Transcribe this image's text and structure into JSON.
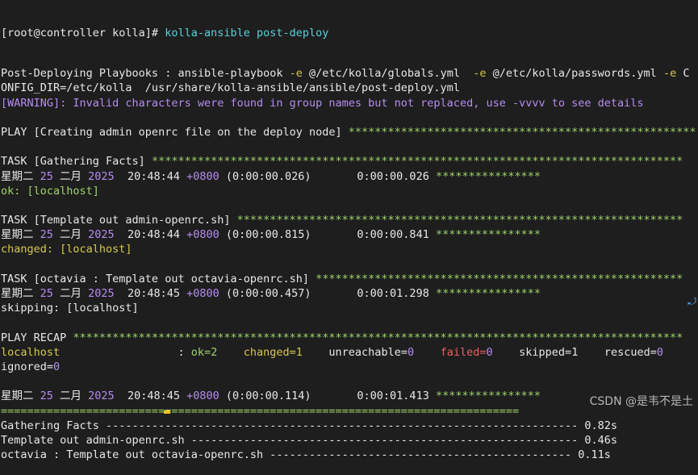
{
  "terminal": {
    "prompt": "[root@controller kolla]# ",
    "command": "kolla-ansible post-deploy",
    "lines": [
      [
        {
          "t": "Post-Deploying Playbooks : ansible-playbook ",
          "c": "w"
        },
        {
          "t": "-e",
          "c": "y"
        },
        {
          "t": " @/etc/kolla/globals.yml  ",
          "c": "w"
        },
        {
          "t": "-e",
          "c": "y"
        },
        {
          "t": " @/etc/kolla/passwords.yml ",
          "c": "w"
        },
        {
          "t": "-e",
          "c": "y"
        },
        {
          "t": " C",
          "c": "w"
        }
      ],
      [
        {
          "t": "ONFIG_DIR=/etc/kolla  /usr/share/kolla-ansible/ansible/post-deploy.yml",
          "c": "w"
        }
      ],
      [
        {
          "t": "[WARNING]: Invalid characters were found in group names but not replaced, use -vvvv to see details",
          "c": "p"
        }
      ],
      [
        {
          "t": "",
          "c": "w"
        }
      ],
      [
        {
          "t": "PLAY [Creating admin openrc file on the deploy node] ",
          "c": "w"
        },
        {
          "t": "*****************************************************",
          "c": "g"
        }
      ],
      [
        {
          "t": "",
          "c": "w"
        }
      ],
      [
        {
          "t": "TASK [Gathering Facts] ",
          "c": "w"
        },
        {
          "t": "*********************************************************************************",
          "c": "g"
        }
      ],
      [
        {
          "t": "星期二 ",
          "c": "w"
        },
        {
          "t": "25",
          "c": "p"
        },
        {
          "t": " 二月 ",
          "c": "w"
        },
        {
          "t": "2025",
          "c": "p"
        },
        {
          "t": "  20:48:44 ",
          "c": "w"
        },
        {
          "t": "+0800",
          "c": "p"
        },
        {
          "t": " (0:00:00.026)       0:00:00.026 ",
          "c": "w"
        },
        {
          "t": "****************",
          "c": "g"
        }
      ],
      [
        {
          "t": "ok: [localhost]",
          "c": "g"
        }
      ],
      [
        {
          "t": "",
          "c": "w"
        }
      ],
      [
        {
          "t": "TASK [Template out admin-openrc.sh] ",
          "c": "w"
        },
        {
          "t": "********************************************************************",
          "c": "g"
        }
      ],
      [
        {
          "t": "星期二 ",
          "c": "w"
        },
        {
          "t": "25",
          "c": "p"
        },
        {
          "t": " 二月 ",
          "c": "w"
        },
        {
          "t": "2025",
          "c": "p"
        },
        {
          "t": "  20:48:44 ",
          "c": "w"
        },
        {
          "t": "+0800",
          "c": "p"
        },
        {
          "t": " (0:00:00.815)       0:00:00.841 ",
          "c": "w"
        },
        {
          "t": "****************",
          "c": "g"
        }
      ],
      [
        {
          "t": "changed: [localhost]",
          "c": "y"
        }
      ],
      [
        {
          "t": "",
          "c": "w"
        }
      ],
      [
        {
          "t": "TASK [octavia : Template out octavia-openrc.sh] ",
          "c": "w"
        },
        {
          "t": "********************************************************",
          "c": "g"
        }
      ],
      [
        {
          "t": "星期二 ",
          "c": "w"
        },
        {
          "t": "25",
          "c": "p"
        },
        {
          "t": " 二月 ",
          "c": "w"
        },
        {
          "t": "2025",
          "c": "p"
        },
        {
          "t": "  20:48:45 ",
          "c": "w"
        },
        {
          "t": "+0800",
          "c": "p"
        },
        {
          "t": " (0:00:00.457)       0:00:01.298 ",
          "c": "w"
        },
        {
          "t": "****************",
          "c": "g"
        }
      ],
      [
        {
          "t": "skipping: [localhost]",
          "c": "w"
        }
      ],
      [
        {
          "t": "",
          "c": "w"
        }
      ],
      [
        {
          "t": "PLAY RECAP ",
          "c": "w"
        },
        {
          "t": "*********************************************************************************************",
          "c": "g"
        }
      ],
      [
        {
          "t": "localhost",
          "c": "y"
        },
        {
          "t": "                  : ",
          "c": "w"
        },
        {
          "t": "ok=2",
          "c": "g"
        },
        {
          "t": "    ",
          "c": "w"
        },
        {
          "t": "changed=1",
          "c": "y"
        },
        {
          "t": "    unreachable=",
          "c": "w"
        },
        {
          "t": "0",
          "c": "p"
        },
        {
          "t": "    ",
          "c": "w"
        },
        {
          "t": "failed=",
          "c": "r"
        },
        {
          "t": "0",
          "c": "p"
        },
        {
          "t": "    skipped=1    rescued=",
          "c": "w"
        },
        {
          "t": "0",
          "c": "p"
        }
      ],
      [
        {
          "t": "ignored=",
          "c": "w"
        },
        {
          "t": "0",
          "c": "p"
        }
      ],
      [
        {
          "t": "",
          "c": "w"
        }
      ],
      [
        {
          "t": "星期二 ",
          "c": "w"
        },
        {
          "t": "25",
          "c": "p"
        },
        {
          "t": " 二月 ",
          "c": "w"
        },
        {
          "t": "2025",
          "c": "p"
        },
        {
          "t": "  20:48:45 ",
          "c": "w"
        },
        {
          "t": "+0800",
          "c": "p"
        },
        {
          "t": " (0:00:00.114)       0:00:01.413 ",
          "c": "w"
        },
        {
          "t": "****************",
          "c": "g"
        }
      ],
      [
        {
          "t": "===============================================================================",
          "c": "g"
        }
      ],
      [
        {
          "t": "Gathering Facts ------------------------------------------------------------------------ 0.82s",
          "c": "w"
        }
      ],
      [
        {
          "t": "Template out admin-openrc.sh ----------------------------------------------------------- 0.46s",
          "c": "w"
        }
      ],
      [
        {
          "t": "octavia : Template out octavia-openrc.sh ---------------------------------------------- 0.11s",
          "c": "w"
        }
      ]
    ]
  },
  "watermark": "CSDN @是韦不是土",
  "colors": {
    "background": "#1e1e1e",
    "green": "#9fd36b",
    "yellow": "#d6c84f",
    "purple": "#b58cf0",
    "cyan": "#5ad1d8",
    "red": "#f06060"
  }
}
